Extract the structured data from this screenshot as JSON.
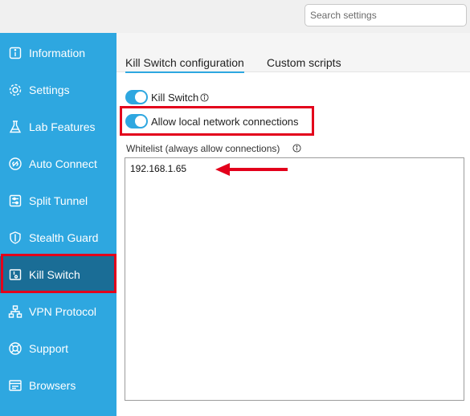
{
  "search": {
    "placeholder": "Search settings"
  },
  "sidebar": {
    "items": [
      {
        "label": "Information",
        "icon": "info-icon"
      },
      {
        "label": "Settings",
        "icon": "gear-icon"
      },
      {
        "label": "Lab Features",
        "icon": "flask-icon"
      },
      {
        "label": "Auto Connect",
        "icon": "link-icon"
      },
      {
        "label": "Split Tunnel",
        "icon": "sliders-icon"
      },
      {
        "label": "Stealth Guard",
        "icon": "shield-icon"
      },
      {
        "label": "Kill Switch",
        "icon": "kill-switch-icon",
        "active": true
      },
      {
        "label": "VPN Protocol",
        "icon": "network-icon"
      },
      {
        "label": "Support",
        "icon": "lifebuoy-icon"
      },
      {
        "label": "Browsers",
        "icon": "browser-icon"
      }
    ]
  },
  "tabs": [
    {
      "label": "Kill Switch configuration",
      "active": true
    },
    {
      "label": "Custom scripts",
      "active": false
    }
  ],
  "options": {
    "kill_switch": {
      "label": "Kill Switch",
      "enabled": true
    },
    "allow_local": {
      "label": "Allow local network connections",
      "enabled": true
    }
  },
  "whitelist": {
    "label": "Whitelist (always allow connections)",
    "value": "192.168.1.65"
  },
  "colors": {
    "sidebar": "#2ea7e0",
    "sidebar_active": "#1a6d96",
    "toggle_on": "#2ea7e0",
    "annotation": "#e3001b"
  }
}
